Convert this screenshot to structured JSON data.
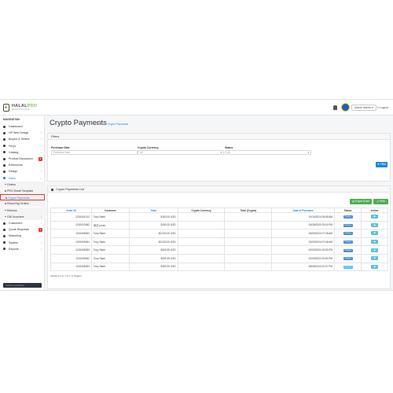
{
  "header": {
    "brand_main": "HALAL",
    "brand_accent": "PRO",
    "brand_tagline": "MARKETPLACE",
    "user_name": "Admin Admin",
    "logout_label": "Logout"
  },
  "sidebar": {
    "heading": "NAVIGATION",
    "items": [
      {
        "label": "Dashboard",
        "icon": "dashboard-icon",
        "chevron": ""
      },
      {
        "label": "HP Web Design",
        "icon": "design-icon",
        "chevron": "›"
      },
      {
        "label": "Buyers & Sellers",
        "icon": "users-icon",
        "chevron": "›"
      },
      {
        "label": "FAQs",
        "icon": "faq-icon",
        "chevron": "›"
      },
      {
        "label": "Catalog",
        "icon": "tag-icon",
        "chevron": "›"
      },
      {
        "label": "Product Discussion",
        "icon": "comments-icon",
        "badge": "1"
      },
      {
        "label": "Extensions",
        "icon": "puzzle-icon",
        "chevron": "›"
      },
      {
        "label": "Design",
        "icon": "monitor-icon",
        "chevron": "›"
      },
      {
        "label": "Sales",
        "icon": "cart-icon",
        "chevron": "⌄"
      }
    ],
    "sales_sub": [
      {
        "label": "Orders",
        "chevron": ""
      },
      {
        "label": "PRO Email Template",
        "chevron": ""
      },
      {
        "label": "Crypto Payments",
        "chevron": ""
      },
      {
        "label": "Recurring Orders",
        "chevron": ""
      },
      {
        "label": "Returns",
        "chevron": ""
      },
      {
        "label": "Gift Vouchers",
        "chevron": "›"
      }
    ],
    "items_after": [
      {
        "label": "Customers",
        "icon": "user-icon",
        "chevron": "›"
      },
      {
        "label": "Quote Requests",
        "icon": "quote-icon",
        "badge": "5"
      },
      {
        "label": "Marketing",
        "icon": "share-icon",
        "chevron": "›"
      },
      {
        "label": "System",
        "icon": "gear-icon",
        "chevron": "›"
      },
      {
        "label": "Reports",
        "icon": "chart-icon",
        "chevron": "›"
      }
    ],
    "search_placeholder": "Search everywhere"
  },
  "page": {
    "title": "Crypto Payments",
    "breadcrumb_home": "Home",
    "breadcrumb_current": "Crypto Payments"
  },
  "filters": {
    "heading": "Filters",
    "purchase_date_label": "Purchase Date",
    "purchase_date_placeholder": "Purchase Date",
    "currency_label": "Crypto Currency",
    "currency_value": "All",
    "status_label": "Status",
    "status_value": "All",
    "filter_button": "Filter"
  },
  "list": {
    "heading": "Crypto Payments List",
    "export_button": "Export Excel",
    "print_button": "Print",
    "columns": [
      "Order ID",
      "Customer",
      "Total",
      "Crypto Currency",
      "Total (Crypto)",
      "Date of Purchase",
      "Status",
      "Action"
    ],
    "rows": [
      {
        "order_id": "1202401012",
        "customer": "Tony Stark",
        "total": "$150.00 USD",
        "currency": "",
        "total_crypto": "",
        "date": "10/15/2024 09:58 AM",
        "status": "Pending",
        "action": "◉"
      },
      {
        "order_id": "1202410062",
        "customer": "测试 prosk",
        "total": "$150.00 USD",
        "currency": "",
        "total_crypto": "",
        "date": "04/26/2024 09:16 PM",
        "status": "Pending",
        "action": "◉"
      },
      {
        "order_id": "1202409062",
        "customer": "Tony Stark",
        "total": "$2,000.00 USD",
        "currency": "",
        "total_crypto": "",
        "date": "03/09/2024 07:48 AM",
        "status": "Pending",
        "action": "◉"
      },
      {
        "order_id": "1202409061",
        "customer": "Tony Stark",
        "total": "$2,000.00 USD",
        "currency": "",
        "total_crypto": "",
        "date": "03/09/2024 07:46 AM",
        "status": "Pending",
        "action": "◉"
      },
      {
        "order_id": "1202409053",
        "customer": "Tony Stark",
        "total": "$269.99 USD",
        "currency": "",
        "total_crypto": "",
        "date": "02/09/2024 09:53 PM",
        "status": "Pending",
        "action": "◉"
      },
      {
        "order_id": "1202409052",
        "customer": "Tony Stark",
        "total": "$269.99 USD",
        "currency": "",
        "total_crypto": "",
        "date": "02/09/2024 09:53 PM",
        "status": "Pending",
        "action": "◉"
      },
      {
        "order_id": "1202408063",
        "customer": "Tony Stark",
        "total": "$150.00 USD",
        "currency": "",
        "total_crypto": "",
        "date": "08/08/2024 02:37 PM",
        "status": "Canceled",
        "action": "◉"
      }
    ],
    "showing_text": "Showing 1 to 7 of 7 (1 Pages)"
  },
  "colors": {
    "accent": "#1e88e5",
    "success": "#4caf50",
    "danger": "#e53935",
    "info": "#5bc0de"
  }
}
